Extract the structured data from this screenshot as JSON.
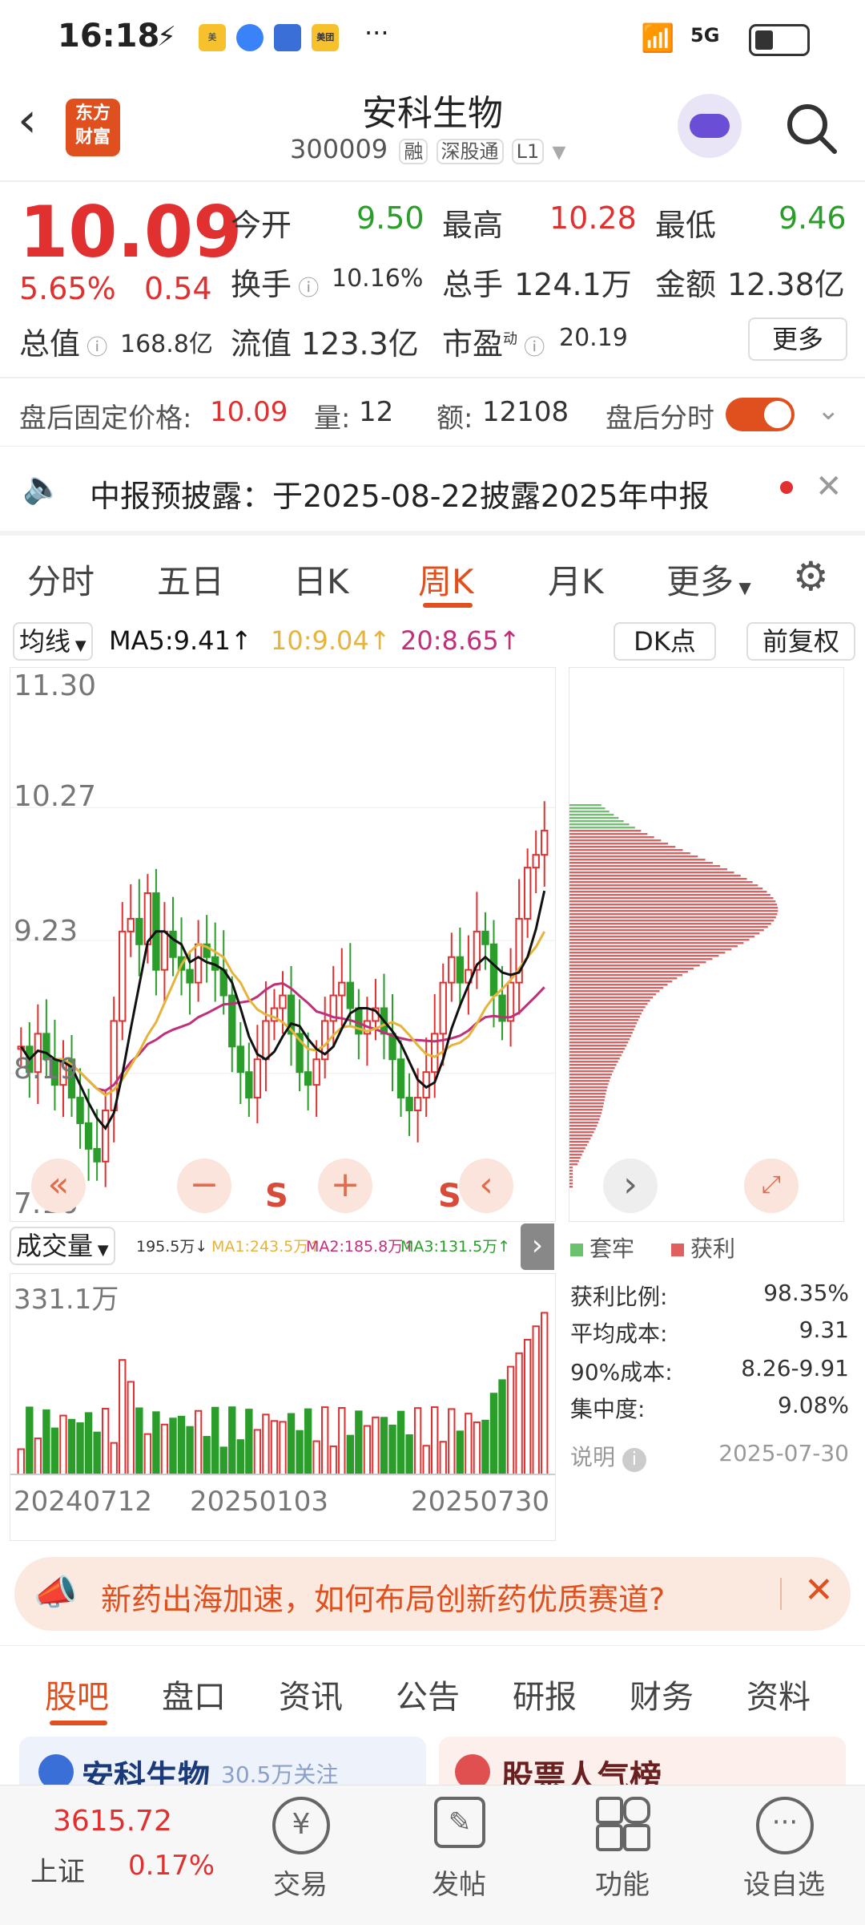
{
  "status_bar": {
    "time": "16:18",
    "net_label": "5G",
    "mini_apps": [
      "美团\n开店宝",
      "",
      "",
      "美团"
    ],
    "more": "···"
  },
  "header": {
    "logo_line1": "东方",
    "logo_line2": "财富",
    "title": "安科生物",
    "code": "300009",
    "tags": [
      "融",
      "深股通",
      "L1"
    ]
  },
  "quote": {
    "price": "10.09",
    "change_pct": "5.65%",
    "change_amt": "0.54",
    "open_label": "今开",
    "open": "9.50",
    "high_label": "最高",
    "high": "10.28",
    "low_label": "最低",
    "low": "9.46",
    "turnover_label": "换手",
    "turnover": "10.16%",
    "volume_label": "总手",
    "volume": "124.1万",
    "amount_label": "金额",
    "amount": "12.38亿",
    "mcap_label": "总值",
    "mcap": "168.8亿",
    "float_label": "流值",
    "float": "123.3亿",
    "pe_label": "市盈",
    "pe_sup": "动",
    "pe": "20.19",
    "more_button": "更多"
  },
  "after_hours": {
    "price_label": "盘后固定价格:",
    "price": "10.09",
    "vol_label": "量:",
    "vol": "12",
    "amt_label": "额:",
    "amt": "12108",
    "toggle_label": "盘后分时"
  },
  "notice": {
    "text": "中报预披露：于2025-08-22披露2025年中报"
  },
  "tabs": [
    "分时",
    "五日",
    "日K",
    "周K",
    "月K",
    "更多"
  ],
  "ma_bar": {
    "selector": "均线",
    "ma5": "MA5:9.41",
    "ma10": "10:9.04",
    "ma20": "20:8.65",
    "dk_button": "DK点",
    "adjust_button": "前复权"
  },
  "price_axis": [
    "11.30",
    "10.27",
    "9.23",
    "8.19",
    "7.16"
  ],
  "volume_bar": {
    "selector": "成交量",
    "v": "195.5万",
    "ma1": "MA1:243.5万",
    "ma2": "MA2:185.8万",
    "ma3": "MA3:131.5万",
    "max_label": "331.1万"
  },
  "date_axis": [
    "20240712",
    "20250103",
    "20250730"
  ],
  "chip": {
    "legend_trapped": "套牢",
    "legend_profit": "获利",
    "rows": [
      {
        "label": "获利比例:",
        "value": "98.35%"
      },
      {
        "label": "平均成本:",
        "value": "9.31"
      },
      {
        "label": "90%成本:",
        "value": "8.26-9.91"
      },
      {
        "label": "集中度:",
        "value": "9.08%"
      }
    ],
    "note_label": "说明",
    "date": "2025-07-30"
  },
  "banner": {
    "text": "新药出海加速，如何布局创新药优质赛道?"
  },
  "bottom_tabs": [
    "股吧",
    "盘口",
    "资讯",
    "公告",
    "研报",
    "财务",
    "资料"
  ],
  "cards": {
    "left_title": "安科生物",
    "left_sub": "30.5万关注",
    "right_title": "股票人气榜"
  },
  "nav": {
    "index_value": "3615.72",
    "index_name": "上证",
    "index_change": "0.17%",
    "items": [
      "交易",
      "发帖",
      "功能",
      "设自选"
    ]
  },
  "colors": {
    "up": "#e03030",
    "down": "#2a9d2a",
    "accent": "#e0501e",
    "ma5": "#111111",
    "ma10": "#e6b43c",
    "ma20": "#c0307a"
  },
  "chart_data": {
    "type": "candlestick",
    "period": "weekly",
    "price_range": [
      7.16,
      11.3
    ],
    "last_close": 10.09,
    "ma": {
      "MA5": 9.41,
      "MA10": 9.04,
      "MA20": 8.65
    }
  }
}
